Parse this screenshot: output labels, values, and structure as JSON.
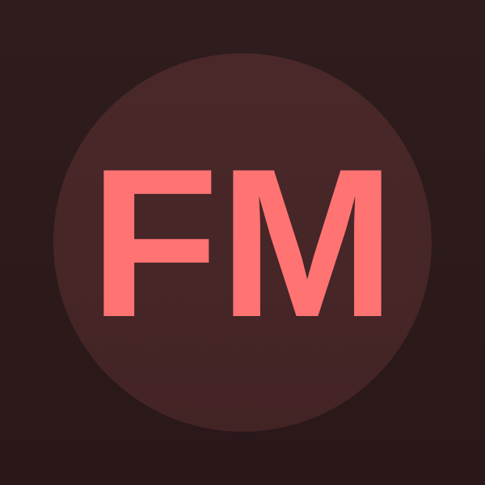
{
  "avatar": {
    "initials": "FM",
    "text_color": "#ff7373",
    "circle_color": "#4a2829",
    "background_color": "#2f1d1e"
  }
}
